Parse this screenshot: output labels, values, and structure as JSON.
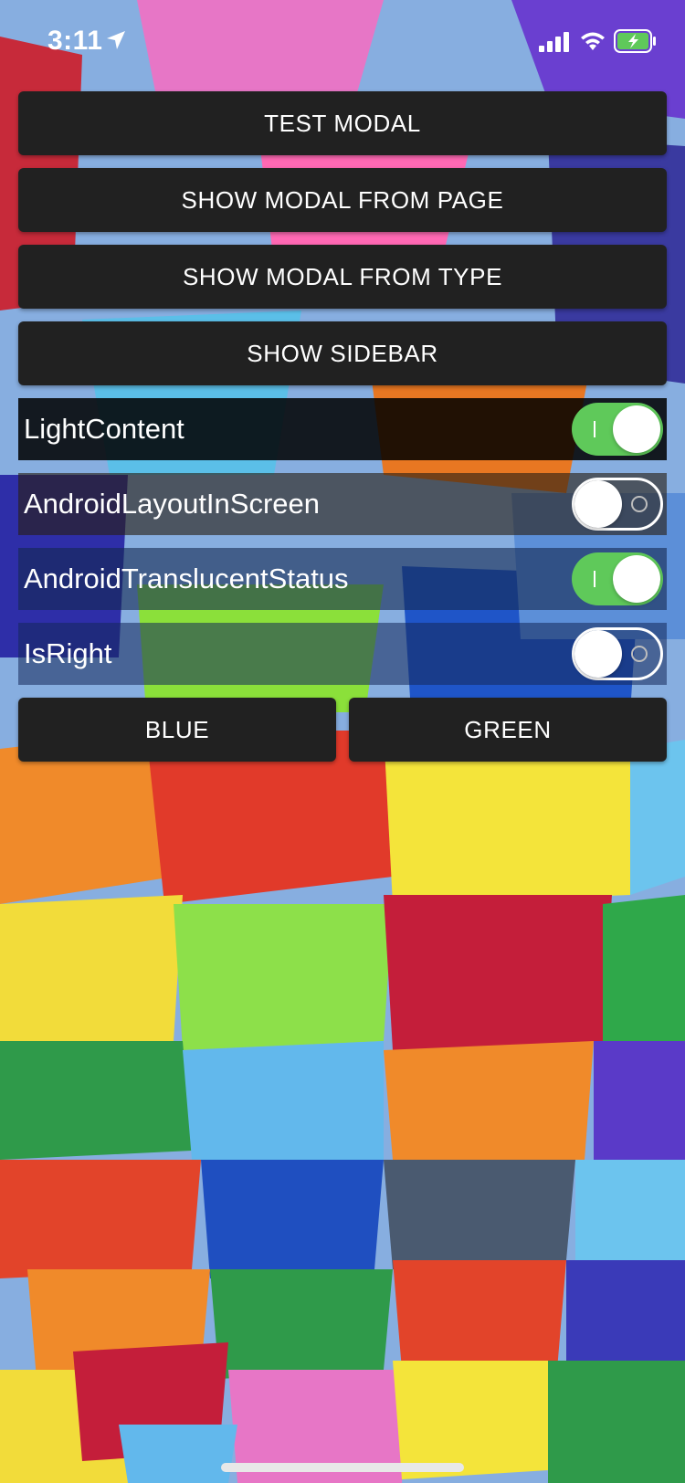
{
  "status_bar": {
    "time": "3:11",
    "icons": [
      "location-arrow-icon",
      "cellular-signal-icon",
      "wifi-icon",
      "battery-charging-icon"
    ],
    "battery_color": "#5fc95a"
  },
  "buttons": {
    "test_modal": "TEST MODAL",
    "show_modal_from_page": "SHOW MODAL FROM PAGE",
    "show_modal_from_type": "SHOW MODAL FROM TYPE",
    "show_sidebar": "SHOW SIDEBAR",
    "blue": "BLUE",
    "green": "GREEN"
  },
  "toggles": [
    {
      "label": "LightContent",
      "on": true
    },
    {
      "label": "AndroidLayoutInScreen",
      "on": false
    },
    {
      "label": "AndroidTranslucentStatus",
      "on": true
    },
    {
      "label": "IsRight",
      "on": false
    }
  ],
  "colors": {
    "button_bg": "#212121",
    "switch_on": "#5fc95a",
    "text": "#ffffff"
  }
}
